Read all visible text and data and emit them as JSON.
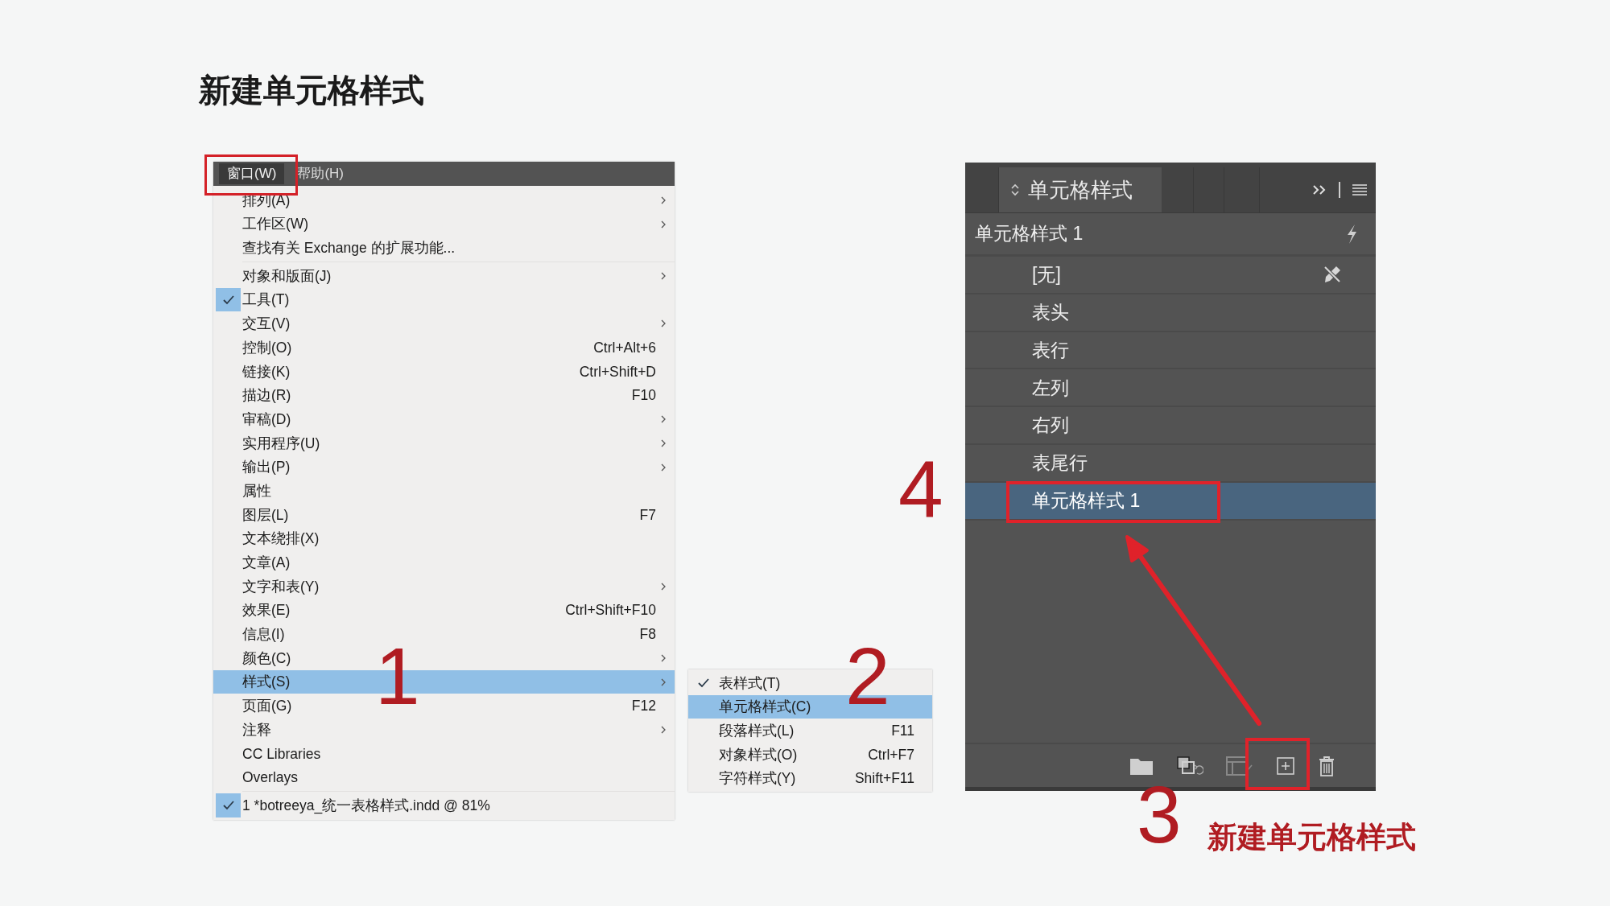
{
  "title": "新建单元格样式",
  "menu": {
    "menubar": [
      {
        "label": "窗口(W)",
        "selected": true
      },
      {
        "label": "帮助(H)",
        "selected": false
      }
    ],
    "items": [
      {
        "kind": "item",
        "label": "排列(A)",
        "has_submenu": true,
        "checked": false,
        "selected": false
      },
      {
        "kind": "item",
        "label": "工作区(W)",
        "has_submenu": true,
        "checked": false,
        "selected": false
      },
      {
        "kind": "item",
        "label": "查找有关 Exchange 的扩展功能...",
        "has_submenu": false,
        "checked": false,
        "selected": false
      },
      {
        "kind": "separator"
      },
      {
        "kind": "item",
        "label": "对象和版面(J)",
        "has_submenu": true,
        "checked": false,
        "selected": false
      },
      {
        "kind": "item",
        "label": "工具(T)",
        "has_submenu": false,
        "checked": true,
        "selected": false
      },
      {
        "kind": "item",
        "label": "交互(V)",
        "has_submenu": true,
        "checked": false,
        "selected": false
      },
      {
        "kind": "item",
        "label": "控制(O)",
        "shortcut": "Ctrl+Alt+6",
        "has_submenu": false,
        "checked": false,
        "selected": false
      },
      {
        "kind": "item",
        "label": "链接(K)",
        "shortcut": "Ctrl+Shift+D",
        "has_submenu": false,
        "checked": false,
        "selected": false
      },
      {
        "kind": "item",
        "label": "描边(R)",
        "shortcut": "F10",
        "has_submenu": false,
        "checked": false,
        "selected": false
      },
      {
        "kind": "item",
        "label": "审稿(D)",
        "has_submenu": true,
        "checked": false,
        "selected": false
      },
      {
        "kind": "item",
        "label": "实用程序(U)",
        "has_submenu": true,
        "checked": false,
        "selected": false
      },
      {
        "kind": "item",
        "label": "输出(P)",
        "has_submenu": true,
        "checked": false,
        "selected": false
      },
      {
        "kind": "item",
        "label": "属性",
        "has_submenu": false,
        "checked": false,
        "selected": false
      },
      {
        "kind": "item",
        "label": "图层(L)",
        "shortcut": "F7",
        "has_submenu": false,
        "checked": false,
        "selected": false
      },
      {
        "kind": "item",
        "label": "文本绕排(X)",
        "has_submenu": false,
        "checked": false,
        "selected": false
      },
      {
        "kind": "item",
        "label": "文章(A)",
        "has_submenu": false,
        "checked": false,
        "selected": false
      },
      {
        "kind": "item",
        "label": "文字和表(Y)",
        "has_submenu": true,
        "checked": false,
        "selected": false
      },
      {
        "kind": "item",
        "label": "效果(E)",
        "shortcut": "Ctrl+Shift+F10",
        "has_submenu": false,
        "checked": false,
        "selected": false
      },
      {
        "kind": "item",
        "label": "信息(I)",
        "shortcut": "F8",
        "has_submenu": false,
        "checked": false,
        "selected": false
      },
      {
        "kind": "item",
        "label": "颜色(C)",
        "has_submenu": true,
        "checked": false,
        "selected": false
      },
      {
        "kind": "item",
        "label": "样式(S)",
        "has_submenu": true,
        "checked": false,
        "selected": true
      },
      {
        "kind": "item",
        "label": "页面(G)",
        "shortcut": "F12",
        "has_submenu": false,
        "checked": false,
        "selected": false
      },
      {
        "kind": "item",
        "label": "注释",
        "has_submenu": true,
        "checked": false,
        "selected": false
      },
      {
        "kind": "item",
        "label": "CC Libraries",
        "has_submenu": false,
        "checked": false,
        "selected": false
      },
      {
        "kind": "item",
        "label": "Overlays",
        "has_submenu": false,
        "checked": false,
        "selected": false
      },
      {
        "kind": "separator"
      },
      {
        "kind": "item",
        "label": "1 *botreeya_统一表格样式.indd @ 81%",
        "has_submenu": false,
        "checked": true,
        "selected": false
      }
    ]
  },
  "submenu": {
    "items": [
      {
        "label": "表样式(T)",
        "checked": true,
        "selected": false
      },
      {
        "label": "单元格样式(C)",
        "checked": false,
        "selected": true
      },
      {
        "label": "段落样式(L)",
        "shortcut": "F11",
        "checked": false,
        "selected": false
      },
      {
        "label": "对象样式(O)",
        "shortcut": "Ctrl+F7",
        "checked": false,
        "selected": false
      },
      {
        "label": "字符样式(Y)",
        "shortcut": "Shift+F11",
        "checked": false,
        "selected": false
      }
    ]
  },
  "panel": {
    "tab": "单元格样式",
    "current_style": "单元格样式 1",
    "styles": [
      {
        "kind": "basic",
        "label": "[无]",
        "selected": false
      },
      {
        "kind": "style",
        "label": "表头",
        "selected": false
      },
      {
        "kind": "style",
        "label": "表行",
        "selected": false
      },
      {
        "kind": "style",
        "label": "左列",
        "selected": false
      },
      {
        "kind": "style",
        "label": "右列",
        "selected": false
      },
      {
        "kind": "style",
        "label": "表尾行",
        "selected": false
      },
      {
        "kind": "style",
        "label": "单元格样式 1",
        "selected": true
      }
    ]
  },
  "steps": [
    "1",
    "2",
    "3",
    "4"
  ],
  "caption": "新建单元格样式"
}
